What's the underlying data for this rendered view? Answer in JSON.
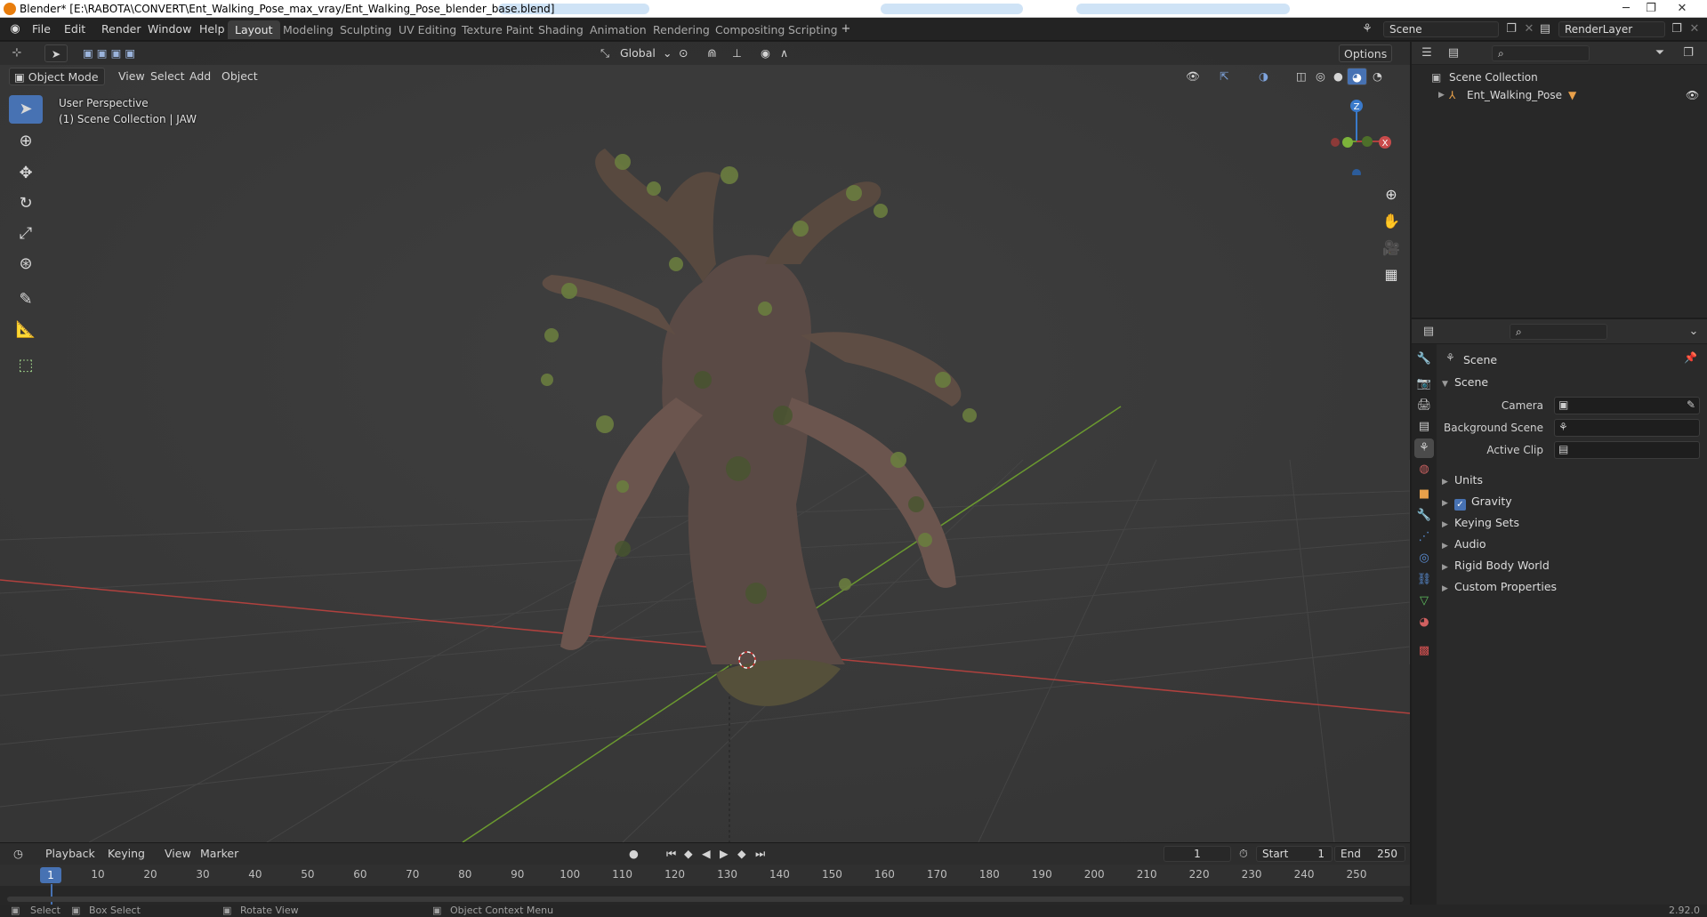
{
  "window": {
    "title": "Blender* [E:\\RABOTA\\CONVERT\\Ent_Walking_Pose_max_vray/Ent_Walking_Pose_blender_base.blend]",
    "controls": [
      "─",
      "❐",
      "✕"
    ]
  },
  "menu": [
    "File",
    "Edit",
    "Render",
    "Window",
    "Help"
  ],
  "workspace_tabs": [
    {
      "label": "Layout",
      "active": true
    },
    {
      "label": "Modeling"
    },
    {
      "label": "Sculpting"
    },
    {
      "label": "UV Editing"
    },
    {
      "label": "Texture Paint"
    },
    {
      "label": "Shading"
    },
    {
      "label": "Animation"
    },
    {
      "label": "Rendering"
    },
    {
      "label": "Compositing"
    },
    {
      "label": "Scripting"
    }
  ],
  "scene_selector": {
    "value": "Scene"
  },
  "view_layer": {
    "value": "RenderLayer"
  },
  "viewport_header": {
    "mode": "Object Mode",
    "menus": [
      "View",
      "Select",
      "Add",
      "Object"
    ],
    "transform_orientation": "Global",
    "options": "Options"
  },
  "viewport_info": {
    "line1": "User Perspective",
    "line2": "(1) Scene Collection | JAW"
  },
  "gizmo": {
    "z": "Z",
    "x": "X"
  },
  "outliner": {
    "root": "Scene Collection",
    "items": [
      {
        "label": "Ent_Walking_Pose"
      }
    ]
  },
  "properties": {
    "breadcrumb": "Scene",
    "section": "Scene",
    "fields": [
      {
        "label": "Camera"
      },
      {
        "label": "Background Scene"
      },
      {
        "label": "Active Clip"
      }
    ],
    "panels": [
      {
        "label": "Units"
      },
      {
        "label": "Gravity",
        "checkbox": true
      },
      {
        "label": "Keying Sets"
      },
      {
        "label": "Audio"
      },
      {
        "label": "Rigid Body World"
      },
      {
        "label": "Custom Properties"
      }
    ]
  },
  "timeline": {
    "menus": [
      "Playback",
      "Keying",
      "View",
      "Marker"
    ],
    "current_frame": "1",
    "start_label": "Start",
    "start": "1",
    "end_label": "End",
    "end": "250",
    "ticks": [
      "1",
      "10",
      "20",
      "30",
      "40",
      "50",
      "60",
      "70",
      "80",
      "90",
      "100",
      "110",
      "120",
      "130",
      "140",
      "150",
      "160",
      "170",
      "180",
      "190",
      "200",
      "210",
      "220",
      "230",
      "240",
      "250"
    ]
  },
  "statusbar": {
    "items": [
      "Select",
      "Box Select",
      "Rotate View",
      "Object Context Menu"
    ],
    "version": "2.92.0"
  },
  "colors": {
    "accent": "#4772b3",
    "axis_x": "#b0413e",
    "axis_y": "#6b9a2f",
    "axis_z": "#3a7acb"
  }
}
